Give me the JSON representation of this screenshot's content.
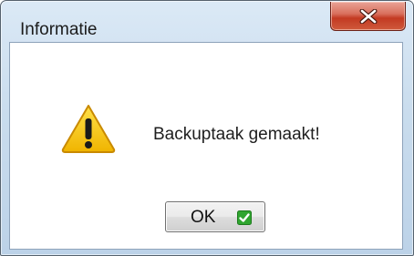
{
  "window": {
    "title": "Informatie"
  },
  "dialog": {
    "message": "Backuptaak gemaakt!",
    "icon": "warning-icon",
    "ok_label": "OK",
    "ok_icon": "checkmark-icon"
  },
  "colors": {
    "warning_yellow": "#f5c400",
    "close_red": "#c33a22",
    "check_green": "#2fa52f"
  }
}
